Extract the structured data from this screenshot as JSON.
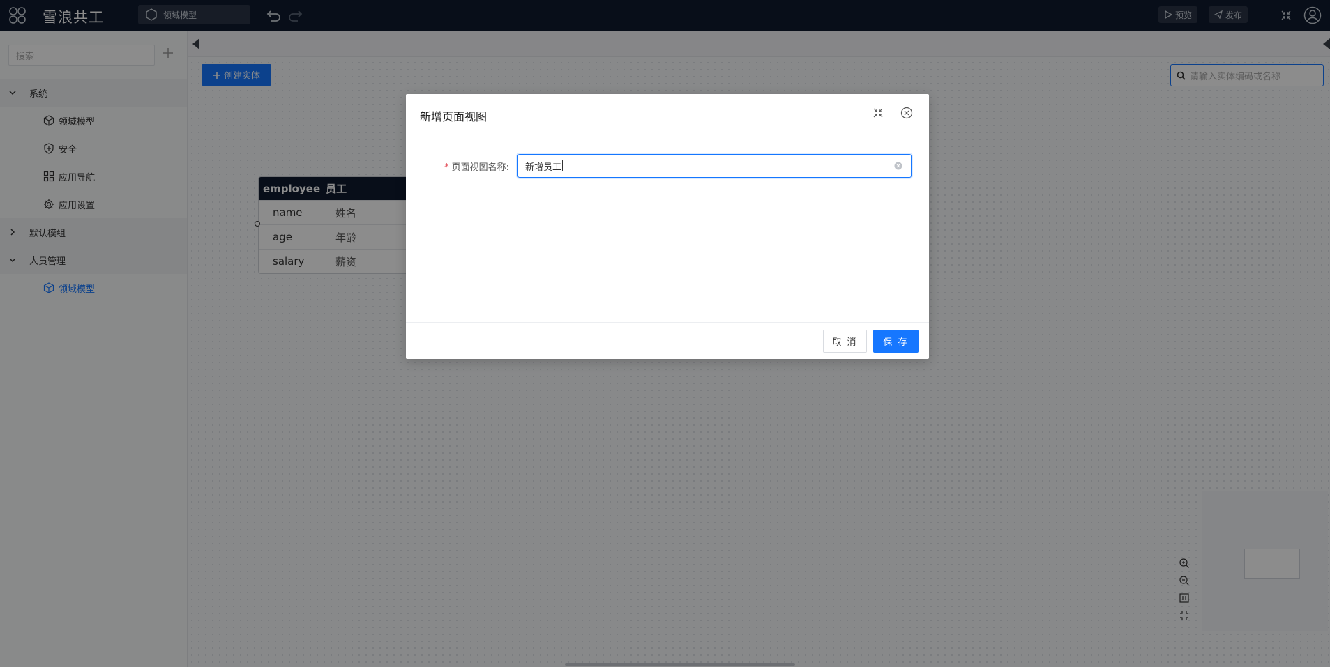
{
  "app": {
    "title": "雪浪共工"
  },
  "topbar": {
    "model_label": "领域模型",
    "preview_label": "预览",
    "publish_label": "发布"
  },
  "sidebar": {
    "search_placeholder": "搜索",
    "groups": [
      {
        "label": "系统",
        "expanded": true,
        "items": [
          {
            "label": "领域模型",
            "icon": "cube-icon"
          },
          {
            "label": "安全",
            "icon": "shield-icon"
          },
          {
            "label": "应用导航",
            "icon": "grid-icon"
          },
          {
            "label": "应用设置",
            "icon": "gear-icon"
          }
        ]
      },
      {
        "label": "默认模组",
        "expanded": false,
        "items": []
      },
      {
        "label": "人员管理",
        "expanded": true,
        "items": [
          {
            "label": "领域模型",
            "icon": "cube-icon",
            "active": true
          }
        ]
      }
    ]
  },
  "canvas": {
    "create_button": "创建实体",
    "entity_search_placeholder": "请输入实体编码或名称",
    "entity": {
      "code": "employee",
      "name": "员工",
      "fields": [
        {
          "code": "name",
          "label": "姓名"
        },
        {
          "code": "age",
          "label": "年龄"
        },
        {
          "code": "salary",
          "label": "薪资"
        }
      ]
    }
  },
  "modal": {
    "title": "新增页面视图",
    "field_label": "页面视图名称:",
    "field_required_mark": "*",
    "field_value": "新增员工",
    "cancel_label": "取 消",
    "save_label": "保 存"
  },
  "colors": {
    "accent": "#1677ff",
    "topbar": "#0f1b2e",
    "required": "#e34d59"
  }
}
